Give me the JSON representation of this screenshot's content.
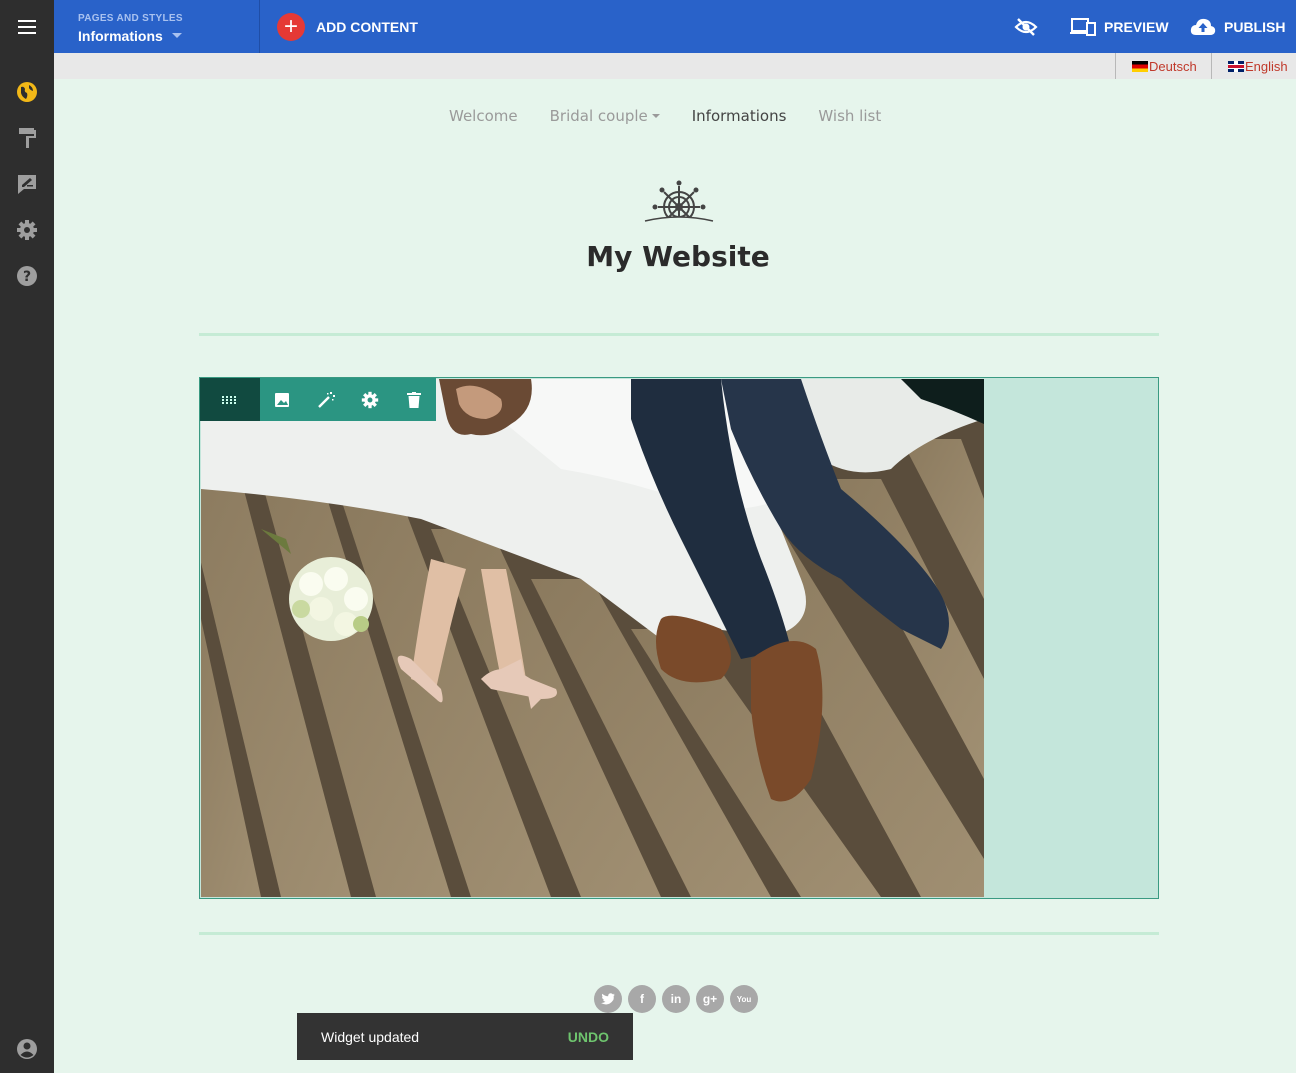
{
  "topbar": {
    "page_selector_label": "PAGES AND STYLES",
    "page_selector_current": "Informations",
    "add_content_label": "ADD CONTENT",
    "preview_label": "PREVIEW",
    "publish_label": "PUBLISH",
    "background_color": "#2962c9"
  },
  "sidebar": {
    "items": [
      {
        "icon": "globe-icon",
        "active": true
      },
      {
        "icon": "paint-roller-icon",
        "active": false
      },
      {
        "icon": "signature-icon",
        "active": false
      },
      {
        "icon": "gear-icon",
        "active": false
      },
      {
        "icon": "help-icon",
        "active": false
      }
    ],
    "bottom_icon": "account-icon",
    "accent_color": "#f2b817"
  },
  "languages": [
    {
      "label": "Deutsch",
      "flag": "de-flag-icon"
    },
    {
      "label": "English",
      "flag": "uk-flag-icon"
    }
  ],
  "site": {
    "nav": [
      {
        "label": "Welcome",
        "active": false
      },
      {
        "label": "Bridal couple",
        "active": false,
        "dropdown": true
      },
      {
        "label": "Informations",
        "active": true
      },
      {
        "label": "Wish list",
        "active": false
      }
    ],
    "title": "My Website"
  },
  "widget_toolbar": [
    "drag-handle-icon",
    "image-icon",
    "magic-wand-icon",
    "gear-icon",
    "trash-icon"
  ],
  "social": [
    {
      "icon": "twitter-icon"
    },
    {
      "icon": "facebook-icon",
      "glyph": "f"
    },
    {
      "icon": "linkedin-icon",
      "glyph": "in"
    },
    {
      "icon": "google-plus-icon",
      "glyph": "g+"
    },
    {
      "icon": "youtube-icon",
      "glyph": "You"
    }
  ],
  "snackbar": {
    "message": "Widget updated",
    "action": "UNDO"
  }
}
